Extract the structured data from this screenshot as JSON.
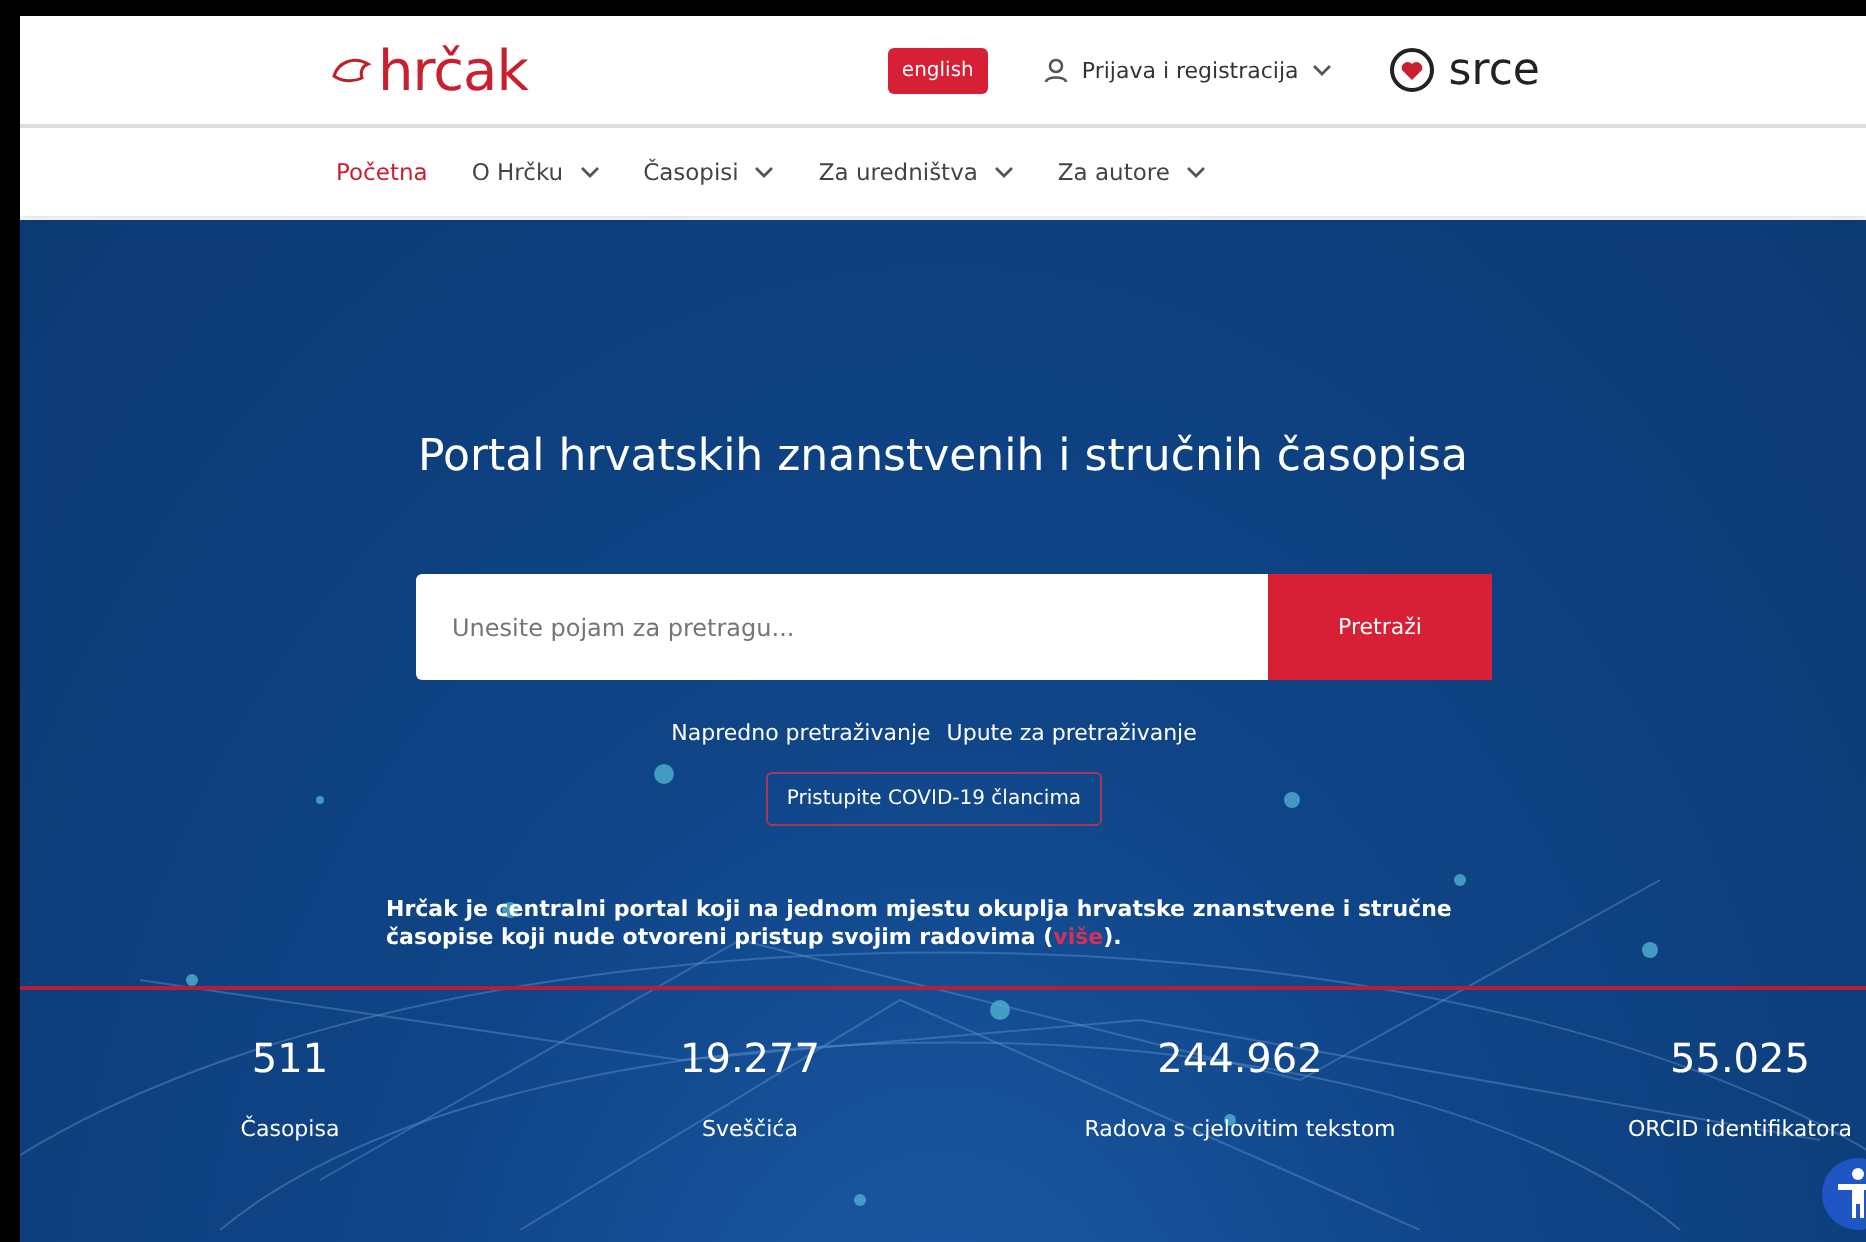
{
  "header": {
    "logo": "hrčak",
    "language_button": "english",
    "login": "Prijava i registracija",
    "partner_logo": "srce"
  },
  "nav": [
    {
      "label": "Početna",
      "selected": true,
      "has_menu": false
    },
    {
      "label": "O Hrčku",
      "selected": false,
      "has_menu": true
    },
    {
      "label": "Časopisi",
      "selected": false,
      "has_menu": true
    },
    {
      "label": "Za uredništva",
      "selected": false,
      "has_menu": true
    },
    {
      "label": "Za autore",
      "selected": false,
      "has_menu": true
    }
  ],
  "hero": {
    "title": "Portal hrvatskih znanstvenih i stručnih časopisa",
    "search": {
      "placeholder": "Unesite pojam za pretragu...",
      "button": "Pretraži"
    },
    "links": [
      "Napredno pretraživanje",
      "Upute za pretraživanje"
    ],
    "covid_button": "Pristupite COVID-19 člancima",
    "intro": {
      "text": "Hrčak je centralni portal koji na jednom mjestu okuplja hrvatske znanstvene i stručne časopise koji nude otvoreni pristup svojim radovima (",
      "link": "više",
      "after": ")."
    }
  },
  "stats": [
    {
      "value": "511",
      "label": "Časopisa"
    },
    {
      "value": "19.277",
      "label": "Sveščića"
    },
    {
      "value": "244.962",
      "label": "Radova s cjelovitim tekstom"
    },
    {
      "value": "55.025",
      "label": "ORCID identifikatora"
    }
  ]
}
